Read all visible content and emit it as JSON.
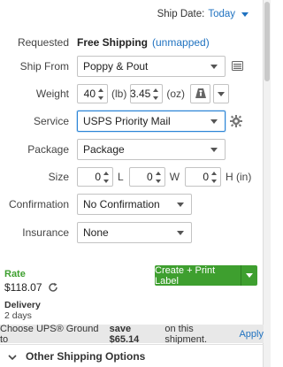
{
  "ship_date": {
    "label": "Ship Date:",
    "value": "Today"
  },
  "requested": {
    "label": "Requested",
    "value": "Free Shipping",
    "note": "(unmapped)"
  },
  "ship_from": {
    "label": "Ship From",
    "value": "Poppy & Pout"
  },
  "weight": {
    "label": "Weight",
    "lb_value": "40",
    "lb_unit": "(lb)",
    "oz_value": "3.45",
    "oz_unit": "(oz)"
  },
  "service": {
    "label": "Service",
    "value": "USPS Priority Mail"
  },
  "package": {
    "label": "Package",
    "value": "Package"
  },
  "size": {
    "label": "Size",
    "length": "0",
    "l_unit": "L",
    "width": "0",
    "w_unit": "W",
    "height": "0",
    "h_unit": "H (in)"
  },
  "confirmation": {
    "label": "Confirmation",
    "value": "No Confirmation"
  },
  "insurance": {
    "label": "Insurance",
    "value": "None"
  },
  "rate": {
    "label": "Rate",
    "value": "$118.07"
  },
  "create_label_button": "Create + Print Label",
  "delivery": {
    "label": "Delivery",
    "value": "2 days"
  },
  "ups_promo": {
    "text_before": "Choose UPS® Ground to",
    "save_text": "save $65.14",
    "text_after": "on this shipment.",
    "apply": "Apply"
  },
  "other_options": "Other Shipping Options",
  "colors": {
    "accent": "#1f72c0",
    "create_button": "#3e9f2f",
    "rate_label": "#3e9f2f"
  }
}
